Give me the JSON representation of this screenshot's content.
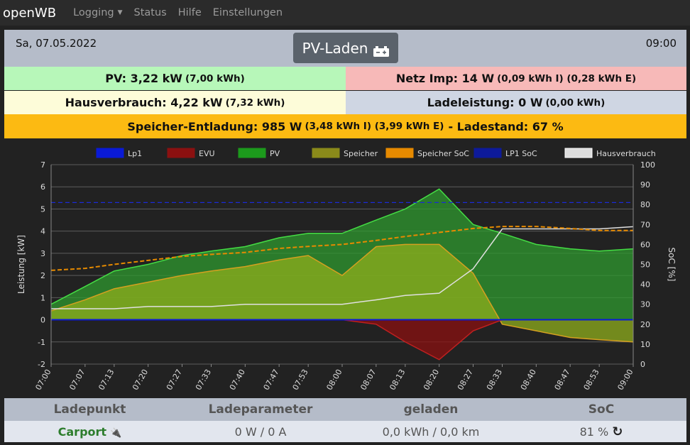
{
  "nav": {
    "brand": "openWB",
    "items": [
      {
        "label": "Logging",
        "dropdown": true
      },
      {
        "label": "Status"
      },
      {
        "label": "Hilfe"
      },
      {
        "label": "Einstellungen"
      }
    ]
  },
  "header": {
    "date": "Sa, 07.05.2022",
    "mode": "PV-Laden",
    "mode_icon": "car-battery-icon",
    "time": "09:00"
  },
  "info": {
    "pv": {
      "main": "PV: 3,22 kW",
      "sub": "(7,00 kWh)"
    },
    "netz": {
      "main": "Netz Imp: 14 W",
      "sub": "(0,09 kWh I) (0,28 kWh E)"
    },
    "haus": {
      "main": "Hausverbrauch: 4,22 kW",
      "sub": "(7,32 kWh)"
    },
    "lade": {
      "main": "Ladeleistung: 0 W",
      "sub": "(0,00 kWh)"
    },
    "speicher": {
      "main": "Speicher-Entladung: 985 W",
      "sub": "(3,48 kWh I) (3,99 kWh E)",
      "tail": "- Ladestand: 67 %"
    }
  },
  "colors": {
    "pv": "#b7f7b9",
    "netz": "#f7b9b8",
    "haus": "#fdfcd9",
    "lade": "#cfd6e3",
    "speicher": "#fcba12"
  },
  "chart_data": {
    "type": "area",
    "xlabel": "",
    "ylabel": "Leistung [kW]",
    "y2label": "SoC [%]",
    "ylim": [
      -2,
      7
    ],
    "y2lim": [
      0,
      100
    ],
    "y_ticks": [
      "-2",
      "-1",
      "0",
      "1",
      "2",
      "3",
      "4",
      "5",
      "6",
      "7"
    ],
    "y2_ticks": [
      "0",
      "10",
      "20",
      "30",
      "40",
      "50",
      "60",
      "70",
      "80",
      "90",
      "100"
    ],
    "x_ticks": [
      "07:00",
      "07:07",
      "07:13",
      "07:20",
      "07:27",
      "07:33",
      "07:40",
      "07:47",
      "07:53",
      "08:00",
      "08:07",
      "08:13",
      "08:20",
      "08:27",
      "08:33",
      "08:40",
      "08:47",
      "08:53",
      "09:00"
    ],
    "legend": [
      {
        "name": "Lp1",
        "color": "#0a1ad6"
      },
      {
        "name": "EVU",
        "color": "#8b1010"
      },
      {
        "name": "PV",
        "color": "#1c9a1c"
      },
      {
        "name": "Speicher",
        "color": "#8a8a1a"
      },
      {
        "name": "Speicher SoC",
        "color": "#e68a00"
      },
      {
        "name": "LP1 SoC",
        "color": "#0d1a9a"
      },
      {
        "name": "Hausverbrauch",
        "color": "#dddddd"
      }
    ],
    "legend_position": "top",
    "series": [
      {
        "name": "PV",
        "x": [
          "07:00",
          "07:07",
          "07:13",
          "07:20",
          "07:27",
          "07:33",
          "07:40",
          "07:47",
          "07:53",
          "08:00",
          "08:07",
          "08:13",
          "08:20",
          "08:27",
          "08:33",
          "08:40",
          "08:47",
          "08:53",
          "09:00"
        ],
        "values": [
          0.7,
          1.5,
          2.2,
          2.5,
          2.9,
          3.1,
          3.3,
          3.7,
          3.9,
          3.9,
          4.5,
          5.0,
          5.9,
          4.3,
          3.9,
          3.4,
          3.2,
          3.1,
          3.2
        ]
      },
      {
        "name": "Speicher",
        "x": [
          "07:00",
          "07:07",
          "07:13",
          "07:20",
          "07:27",
          "07:33",
          "07:40",
          "07:47",
          "07:53",
          "08:00",
          "08:07",
          "08:13",
          "08:20",
          "08:27",
          "08:33",
          "08:40",
          "08:47",
          "08:53",
          "09:00"
        ],
        "values": [
          0.4,
          0.9,
          1.4,
          1.7,
          2.0,
          2.2,
          2.4,
          2.7,
          2.9,
          2.0,
          3.3,
          3.4,
          3.4,
          2.1,
          -0.2,
          -0.5,
          -0.8,
          -0.9,
          -1.0
        ]
      },
      {
        "name": "EVU",
        "x": [
          "07:00",
          "07:07",
          "07:13",
          "07:20",
          "07:27",
          "07:33",
          "07:40",
          "07:47",
          "07:53",
          "08:00",
          "08:07",
          "08:13",
          "08:20",
          "08:27",
          "08:33",
          "08:40",
          "08:47",
          "08:53",
          "09:00"
        ],
        "values": [
          0,
          0,
          0,
          0,
          0,
          0,
          0,
          0,
          0,
          0,
          -0.2,
          -1.0,
          -1.8,
          -0.5,
          0,
          0,
          0,
          0,
          0
        ]
      },
      {
        "name": "Hausverbrauch",
        "x": [
          "07:00",
          "07:07",
          "07:13",
          "07:20",
          "07:27",
          "07:33",
          "07:40",
          "07:47",
          "07:53",
          "08:00",
          "08:07",
          "08:13",
          "08:20",
          "08:27",
          "08:33",
          "08:40",
          "08:47",
          "08:53",
          "09:00"
        ],
        "values": [
          0.5,
          0.5,
          0.5,
          0.6,
          0.6,
          0.6,
          0.7,
          0.7,
          0.7,
          0.7,
          0.9,
          1.1,
          1.2,
          2.3,
          4.1,
          4.1,
          4.1,
          4.1,
          4.2
        ]
      },
      {
        "name": "Speicher SoC",
        "x": [
          "07:00",
          "07:07",
          "07:13",
          "07:20",
          "07:27",
          "07:33",
          "07:40",
          "07:47",
          "07:53",
          "08:00",
          "08:07",
          "08:13",
          "08:20",
          "08:27",
          "08:33",
          "08:40",
          "08:47",
          "08:53",
          "09:00"
        ],
        "values": [
          47,
          48,
          50,
          52,
          54,
          55,
          56,
          58,
          59,
          60,
          62,
          64,
          66,
          68,
          69,
          69,
          68,
          67,
          67
        ]
      },
      {
        "name": "LP1 SoC",
        "x": [
          "07:00",
          "09:00"
        ],
        "values": [
          81,
          81
        ]
      },
      {
        "name": "Lp1",
        "x": [
          "07:00",
          "09:00"
        ],
        "values": [
          0,
          0
        ]
      }
    ]
  },
  "table": {
    "headers": [
      "Ladepunkt",
      "Ladeparameter",
      "geladen",
      "SoC"
    ],
    "row": {
      "name": "Carport",
      "plug_icon": "plug-icon",
      "params": "0 W / 0 A",
      "charged": "0,0 kWh / 0,0 km",
      "soc": "81 %",
      "refresh_icon": "refresh-icon"
    }
  }
}
